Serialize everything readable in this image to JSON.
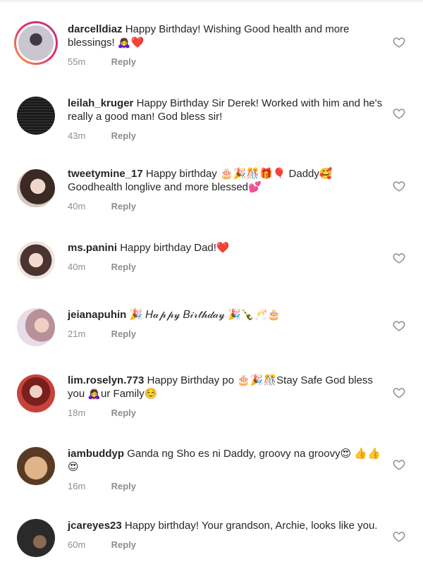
{
  "comments": [
    {
      "username": "darcelldiaz",
      "text": "Happy Birthday! Wishing Good health and more blessings! 🙇‍♀️❤️",
      "time": "55m",
      "reply": "Reply",
      "has_story": true,
      "avatar_colors": [
        "#c9c6d2",
        "#3f3a48"
      ]
    },
    {
      "username": "leilah_kruger",
      "text": "Happy Birthday Sir Derek! Worked with him and he's really a good man! God bless sir!",
      "time": "43m",
      "reply": "Reply",
      "has_story": false,
      "avatar_colors": [
        "#1a1a1a",
        "#3a3a3a"
      ]
    },
    {
      "username": "tweetymine_17",
      "text": "Happy birthday 🎂🎉🎊🎁🎈 Daddy🥰 Goodhealth longlive and more blessed💕",
      "time": "40m",
      "reply": "Reply",
      "has_story": false,
      "avatar_colors": [
        "#d8c6c0",
        "#3b2a24"
      ]
    },
    {
      "username": "ms.panini",
      "text": "Happy birthday Dad!❤️",
      "time": "40m",
      "reply": "Reply",
      "has_story": false,
      "avatar_colors": [
        "#efe4e0",
        "#4a3430"
      ]
    },
    {
      "username": "jeianapuhin",
      "text": "🎉 𝐻𝒶𝓅𝓅𝓎 𝐵𝒾𝓇𝓉𝒽𝒹𝒶𝓎 🎉🍾🥂🎂",
      "time": "21m",
      "reply": "Reply",
      "has_story": false,
      "avatar_colors": [
        "#e6dde6",
        "#b8909a"
      ]
    },
    {
      "username": "lim.roselyn.773",
      "text": "Happy Birthday po 🎂🎉🎊Stay Safe God bless you 🙇‍♀️ur Family☺️",
      "time": "18m",
      "reply": "Reply",
      "has_story": false,
      "avatar_colors": [
        "#c8423c",
        "#7a1f1c"
      ]
    },
    {
      "username": "iambuddyp",
      "text": "Ganda ng Sho es ni Daddy, groovy na groovy😍 👍👍😍",
      "time": "16m",
      "reply": "Reply",
      "has_story": false,
      "avatar_colors": [
        "#e0b48a",
        "#5a3a22"
      ]
    },
    {
      "username": "jcareyes23",
      "text": "Happy birthday! Your grandson, Archie, looks like you.",
      "time": "60m",
      "reply": "Reply",
      "has_story": false,
      "avatar_colors": [
        "#2a2a2a",
        "#8a6a52"
      ]
    }
  ],
  "icons": {
    "like": "heart-outline-icon"
  },
  "colors": {
    "text": "#262626",
    "muted": "#8e8e8e",
    "story_ring_start": "#f9a53b",
    "story_ring_end": "#c13584"
  }
}
